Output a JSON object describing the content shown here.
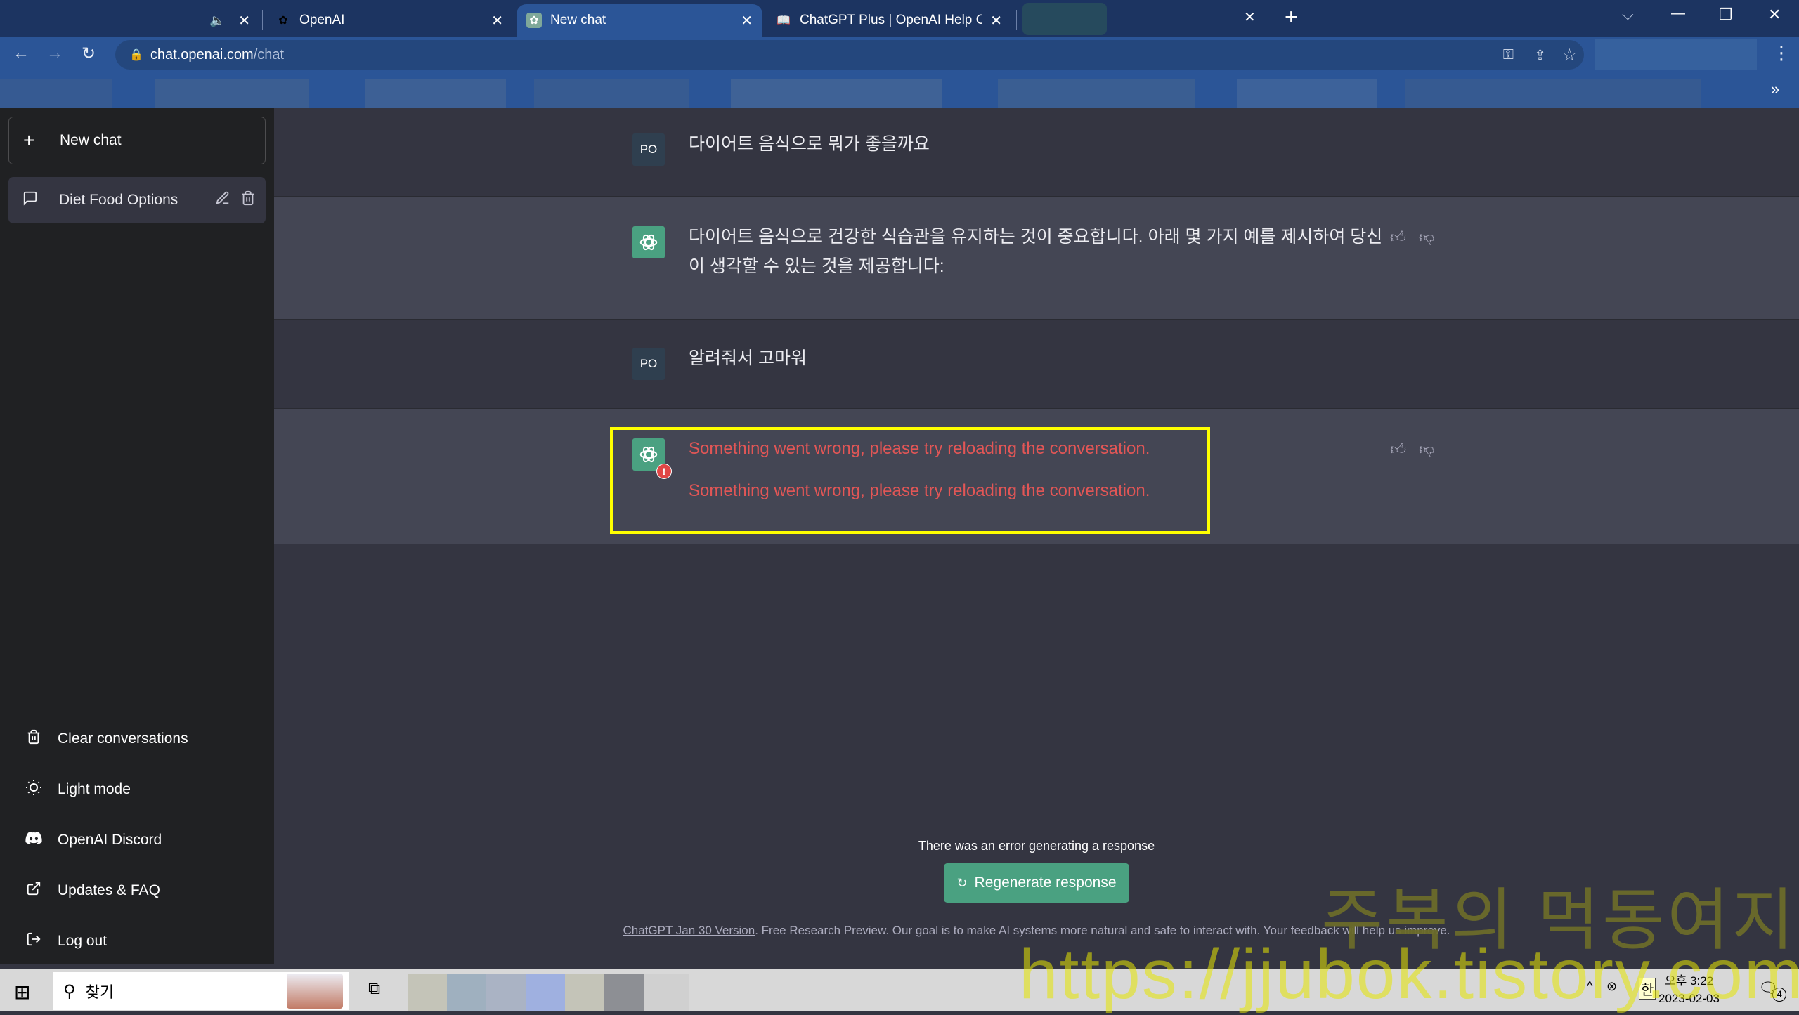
{
  "browser": {
    "tabs": [
      {
        "title": "",
        "favicon": "speaker-icon",
        "muted_indicator": "🔈",
        "active": false
      },
      {
        "title": "OpenAI",
        "favicon": "openai-logo-icon",
        "active": false
      },
      {
        "title": "New chat",
        "favicon": "chatgpt-logo-icon",
        "active": true
      },
      {
        "title": "ChatGPT Plus | OpenAI Help Ce",
        "favicon": "book-icon",
        "active": false
      }
    ],
    "close_glyph": "✕",
    "new_tab_glyph": "+",
    "url_host": "chat.openai.com",
    "url_path": "/chat",
    "window_controls": {
      "dropdown": "⌵",
      "minimize": "—",
      "restore": "❐",
      "close": "✕"
    }
  },
  "sidebar": {
    "new_chat_label": "New chat",
    "conversations": [
      {
        "title": "Diet Food Options"
      }
    ],
    "menu": [
      {
        "label": "Clear conversations",
        "icon": "trash-icon"
      },
      {
        "label": "Light mode",
        "icon": "sun-icon"
      },
      {
        "label": "OpenAI Discord",
        "icon": "discord-icon"
      },
      {
        "label": "Updates & FAQ",
        "icon": "external-link-icon"
      },
      {
        "label": "Log out",
        "icon": "logout-icon"
      }
    ]
  },
  "conversation": {
    "user_initials": "PO",
    "messages": [
      {
        "role": "user",
        "text": "다이어트 음식으로 뭐가 좋을까요"
      },
      {
        "role": "assistant",
        "text": "다이어트 음식으로 건강한 식습관을 유지하는 것이 중요합니다. 아래 몇 가지 예를 제시하여 당신이 생각할 수 있는 것을 제공합니다:"
      },
      {
        "role": "user",
        "text": "알려줘서 고마워"
      },
      {
        "role": "assistant",
        "error": true,
        "lines": [
          "Something went wrong, please try reloading the conversation.",
          "Something went wrong, please try reloading the conversation."
        ]
      }
    ],
    "error_badge": "!"
  },
  "footer": {
    "error_text": "There was an error generating a response",
    "regenerate_label": "Regenerate response",
    "disclaimer_link": "ChatGPT Jan 30 Version",
    "disclaimer_text": ". Free Research Preview. Our goal is to make AI systems more natural and safe to interact with. Your feedback will help us improve."
  },
  "watermark": {
    "korean": "주복의 먹동여지도",
    "url": "https://jjubok.tistory.com"
  },
  "taskbar": {
    "search_label": "찾기",
    "ime": "한",
    "time": "오후 3:22",
    "date": "2023-02-03",
    "notification_count": "4"
  },
  "colors": {
    "accent_green": "#4aa181",
    "error_red": "#e25656",
    "highlight_yellow": "#ffff00"
  }
}
